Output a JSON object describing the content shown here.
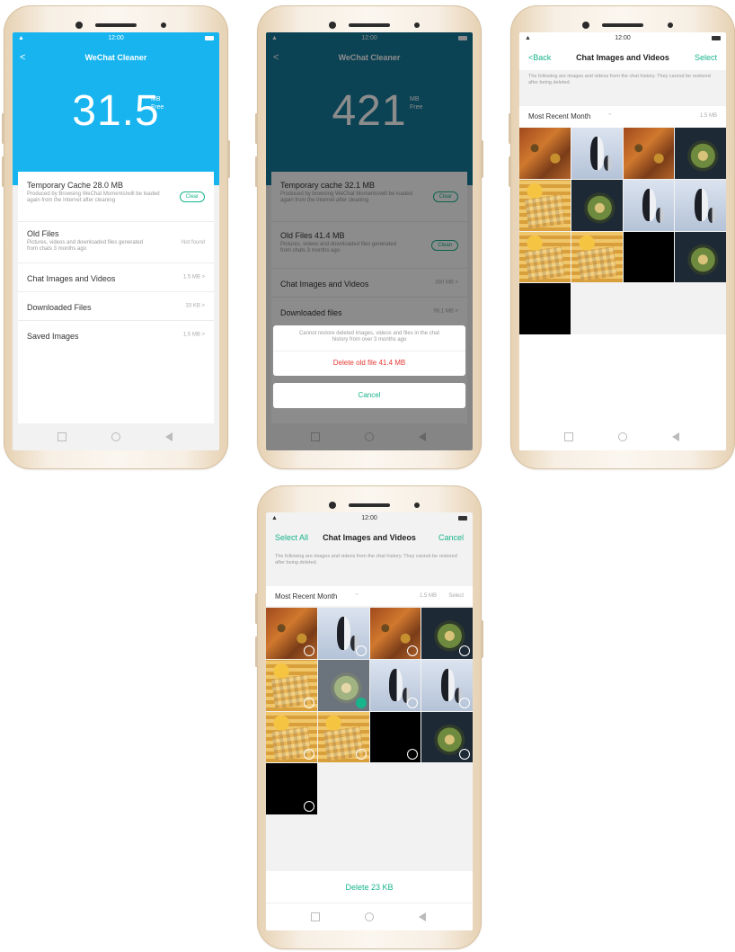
{
  "status": {
    "time": "12:00"
  },
  "phone1": {
    "title": "WeChat Cleaner",
    "back": "<",
    "amount": "31.5",
    "unit_top": "MB",
    "unit_bottom": "Free",
    "rows": [
      {
        "title": "Temporary Cache 28.0 MB",
        "desc": "Produced by Browsing WeChat Moments/will be loaded again from the Internet after cleaning",
        "action": "Clear"
      },
      {
        "title": "Old Files",
        "desc": "Pictures, videos and downloaded files generated from chats 3 months ago",
        "value": "Not found"
      },
      {
        "title": "Chat Images and Videos",
        "value": "1.5 MB >"
      },
      {
        "title": "Downloaded Files",
        "value": "33 KB >"
      },
      {
        "title": "Saved Images",
        "value": "1.5 MB >"
      }
    ]
  },
  "phone2": {
    "title": "WeChat Cleaner",
    "back": "<",
    "amount": "421",
    "unit_top": "MB",
    "unit_bottom": "Free",
    "rows": [
      {
        "title": "Temporary cache 32.1 MB",
        "desc": "Produced by browsing WeChat Moments/will be loaded again from the Internet after cleaning",
        "action": "Clear"
      },
      {
        "title": "Old Files 41.4 MB",
        "desc": "Pictures, videos and downloaded files generated from chats 3 months ago",
        "action": "Clean"
      },
      {
        "title": "Chat Images and Videos",
        "value": "380 MB >"
      },
      {
        "title": "Downloaded files",
        "value": "96.1 MB >"
      }
    ],
    "sheet_note": "Cannot restore deleted images, videos and files in the chat history from over 3 months ago",
    "delete_label": "Delete old file 41.4 MB",
    "cancel_label": "Cancel"
  },
  "phone3": {
    "back": "<Back",
    "title": "Chat Images and Videos",
    "select": "Select",
    "note": "The following are images and videos from the chat history. They cannot be restored after being deleted.",
    "section": "Most Recent Month",
    "size": "1.5 MB"
  },
  "phone4": {
    "select_all": "Select All",
    "title": "Chat Images and Videos",
    "cancel": "Cancel",
    "note": "The following are images and videos from the chat history. They cannot be restored after being deleted.",
    "section": "Most Recent Month",
    "size": "1.5 MB",
    "section_select": "Select",
    "delete_label": "Delete 23 KB"
  },
  "grid_images": [
    "food",
    "penguin",
    "food",
    "salad",
    "waffle",
    "salad",
    "penguin",
    "penguin",
    "waffle",
    "waffle",
    "black",
    "salad",
    "black"
  ],
  "colors": {
    "accent": "#19b38c",
    "hero_blue": "#17b4f0",
    "hero_dim": "#177a9a",
    "danger": "#e53935"
  }
}
